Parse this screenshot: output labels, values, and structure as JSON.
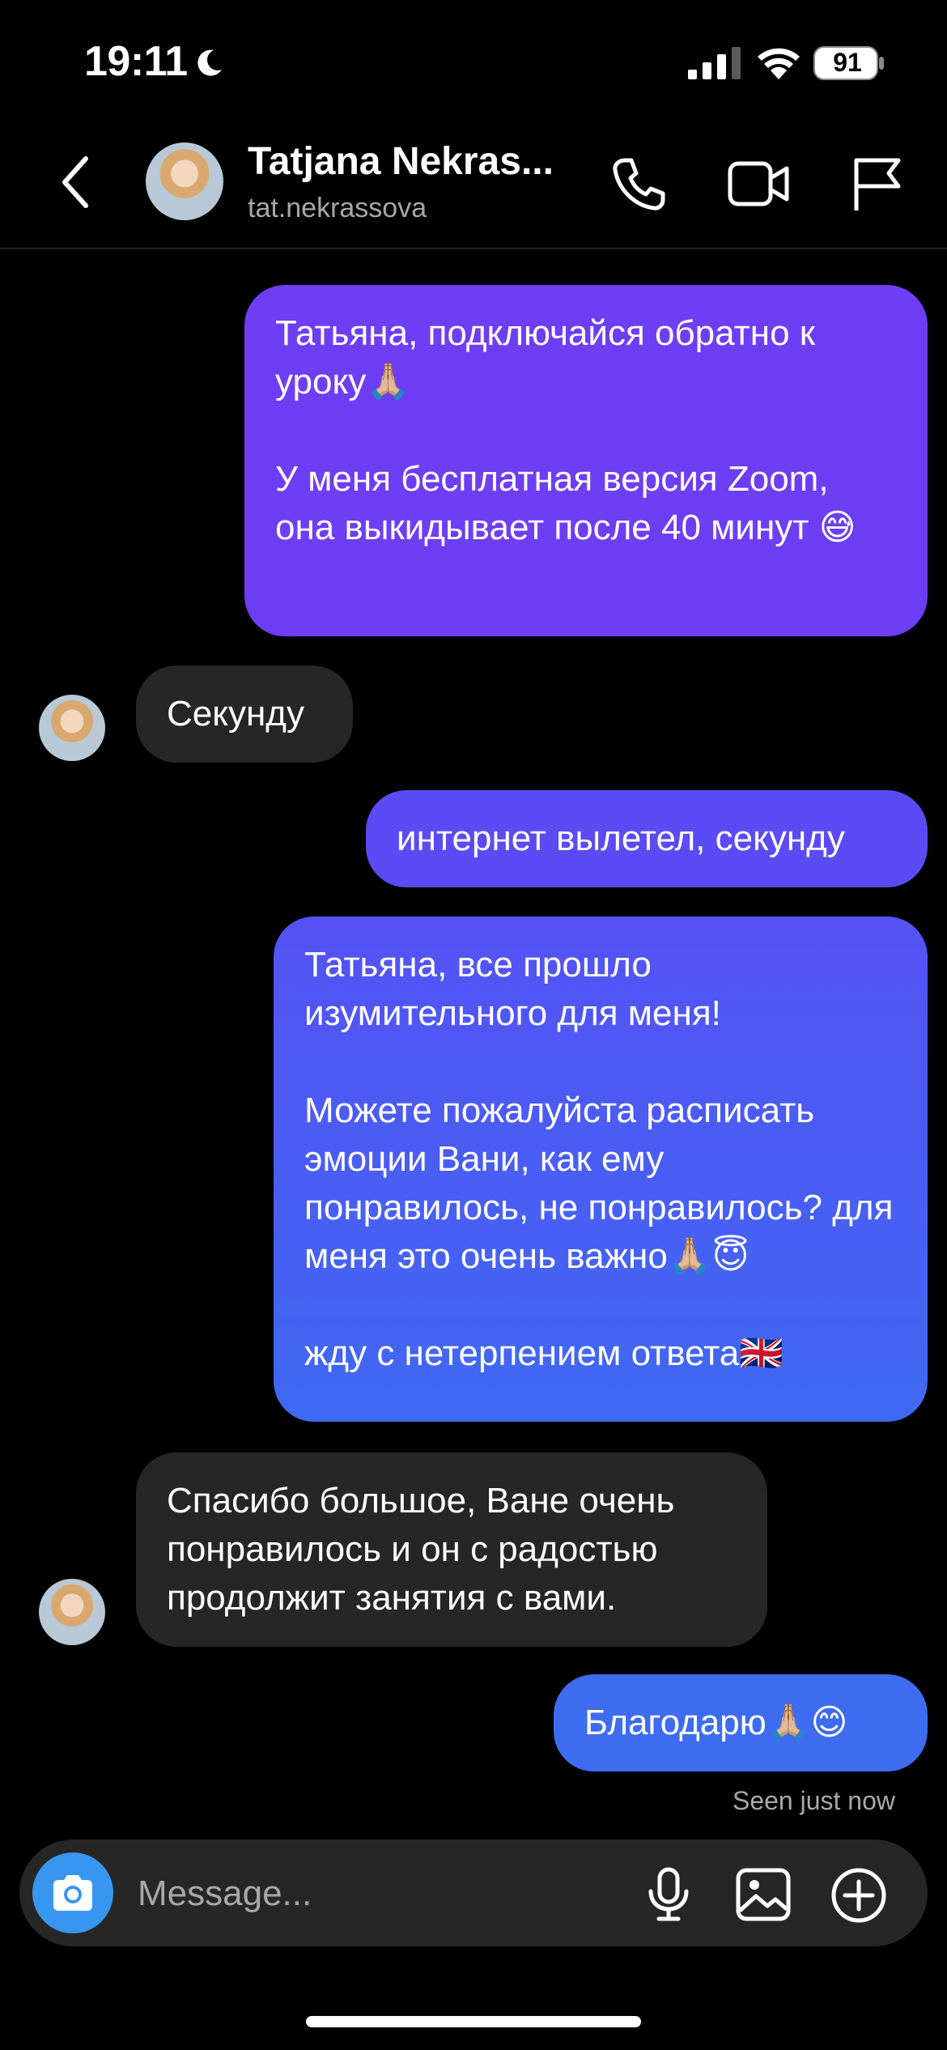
{
  "status_bar": {
    "time": "19:11",
    "battery": "91"
  },
  "header": {
    "name": "Tatjana Nekras...",
    "username": "tat.nekrassova"
  },
  "messages": [
    {
      "side": "sent",
      "text": "Татьяна, подключайся обратно к уроку🙏🏼\n\nУ меня бесплатная версия Zoom, она выкидывает после 40 минут 😅"
    },
    {
      "side": "received",
      "text": "Секунду"
    },
    {
      "side": "sent",
      "text": "интернет вылетел, секунду"
    },
    {
      "side": "sent",
      "text": "Татьяна, все прошло изумительного для меня!\n\nМожете пожалуйста расписать эмоции Вани, как ему понравилось, не понравилось? для меня это очень важно🙏🏼😇\n\nжду с нетерпением ответа🇬🇧"
    },
    {
      "side": "received",
      "text": "Спасибо большое, Ване очень понравилось и он с радостью продолжит занятия с вами."
    },
    {
      "side": "sent",
      "text": "Благодарю🙏🏼😊"
    }
  ],
  "seen_status": "Seen just now",
  "composer": {
    "placeholder": "Message..."
  },
  "colors": {
    "background": "#000000",
    "received_bubble": "#262626",
    "sent_top": "#7b3ff2",
    "sent_bottom": "#3b82f6",
    "camera_button": "#3797f0"
  },
  "icons": [
    "moon-icon",
    "signal-icon",
    "wifi-icon",
    "battery-icon",
    "back-chevron-icon",
    "phone-icon",
    "video-icon",
    "flag-icon",
    "camera-icon",
    "microphone-icon",
    "gallery-icon",
    "plus-circle-icon"
  ]
}
